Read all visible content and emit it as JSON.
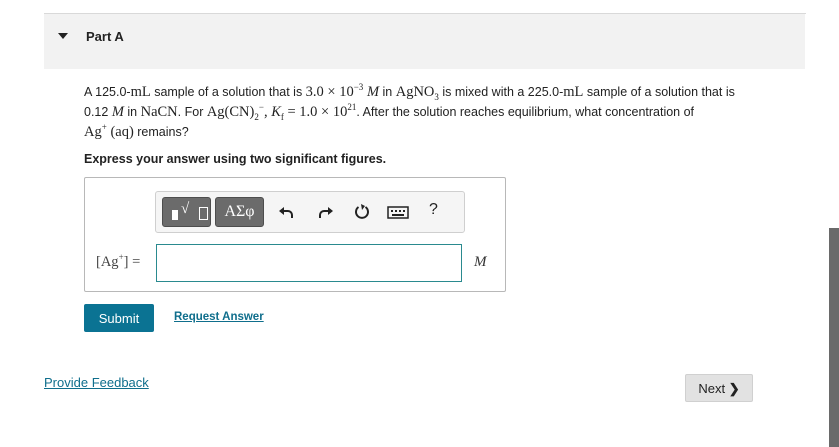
{
  "part": {
    "title": "Part A"
  },
  "question": {
    "l1_a": "A 125.0-",
    "l1_ml1": "mL",
    "l1_b": " sample of a solution that is ",
    "l1_num": "3.0 × 10",
    "l1_exp": "−3",
    "l1_M": "M",
    "l1_c": " in ",
    "l1_agno": "AgNO",
    "l1_agno_sub": "3",
    "l1_d": " is mixed with a 225.0-",
    "l1_ml2": "mL",
    "l1_e": " sample of a solution that is",
    "l2_a": "0.12 ",
    "l2_M": "M",
    "l2_b": " in ",
    "l2_nacn": "NaCN",
    "l2_c": ". For ",
    "l2_complex": "Ag(CN)",
    "l2_complex_sub": "2",
    "l2_complex_sup": "−",
    "l2_d": ", ",
    "l2_kf": "K",
    "l2_kf_sub": "f",
    "l2_kf_val": " = 1.0 × 10",
    "l2_kf_exp": "21",
    "l2_e": ". After the solution reaches equilibrium, what concentration of",
    "l3_ag": "Ag",
    "l3_ag_sup": "+",
    "l3_aq": "(aq)",
    "l3_b": " remains?"
  },
  "instruction": "Express your answer using two significant figures.",
  "toolbar": {
    "greek_label": "ΑΣφ",
    "help_label": "?"
  },
  "answer": {
    "label_open": "[Ag",
    "label_sup": "+",
    "label_close": "] =",
    "value": "",
    "unit": "M"
  },
  "buttons": {
    "submit": "Submit",
    "request_answer": "Request Answer",
    "provide_feedback": "Provide Feedback",
    "next": "Next"
  }
}
